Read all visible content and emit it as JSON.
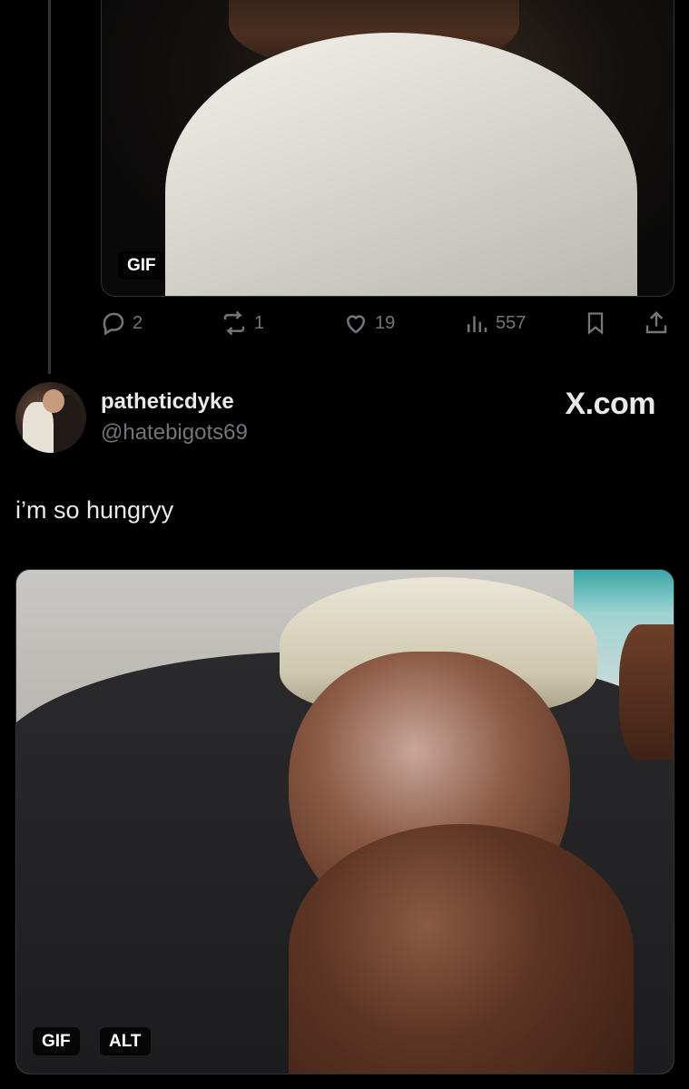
{
  "previous_tweet": {
    "media_badge": "GIF",
    "actions": {
      "replies": "2",
      "reposts": "1",
      "likes": "19",
      "views": "557"
    }
  },
  "tweet": {
    "display_name": "patheticdyke",
    "handle": "@hatebigots69",
    "brand": "X.com",
    "text": "i’m so hungryy",
    "media_badges": [
      "GIF",
      "ALT"
    ]
  },
  "colors": {
    "background": "#000000",
    "text_primary": "#e7e9ea",
    "text_secondary": "#71767b",
    "border": "#2f3336"
  },
  "icons": [
    "reply-icon",
    "repost-icon",
    "like-icon",
    "views-icon",
    "bookmark-icon",
    "share-icon"
  ]
}
